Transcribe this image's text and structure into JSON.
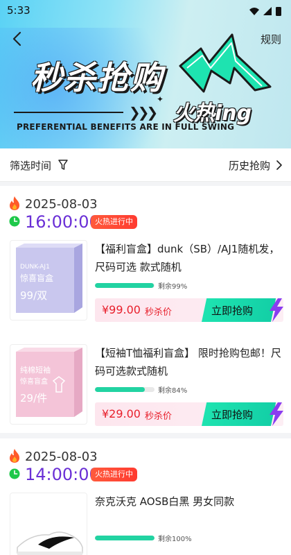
{
  "status_bar": {
    "time": "5:33"
  },
  "header": {
    "rules_label": "规则",
    "banner_title": "秒杀抢购",
    "banner_slogan": "火热ing",
    "banner_subtitle": "PREFERENTIAL BENEFITS ARE IN FULL SWING"
  },
  "filter": {
    "label": "筛选时间",
    "history_label": "历史抢购"
  },
  "sessions": [
    {
      "date": "2025-08-03",
      "time": "16:00:00",
      "badge": "火热进行中",
      "products": [
        {
          "name": "【福利盲盒】dunk（SB）/AJ1随机发，尺码可选 款式随机",
          "remain_text": "剩余99%",
          "remain_fraction": 0.99,
          "price": "¥99.00",
          "price_tag": "秒杀价",
          "buy_label": "立即抢购",
          "box_line1": "DUNK-AJ1",
          "box_line2": "惊喜盲盒",
          "box_price": "99/双",
          "box_color": "#c9c7ee"
        },
        {
          "name": "【短袖T恤福利盲盒】 限时抢购包邮！尺码可选款式随机",
          "remain_text": "剩余84%",
          "remain_fraction": 0.84,
          "price": "¥29.00",
          "price_tag": "秒杀价",
          "buy_label": "立即抢购",
          "box_line1": "纯棉短袖",
          "box_line2": "惊喜盲盒",
          "box_price": "29/件",
          "box_color": "#f4c4d8"
        }
      ]
    },
    {
      "date": "2025-08-03",
      "time": "14:00:00",
      "badge": "火热进行中",
      "products": [
        {
          "name": "奈克沃克 AOSB白黑 男女同款",
          "remain_text": "剩余100%",
          "remain_fraction": 1.0
        }
      ]
    }
  ],
  "colors": {
    "accent_purple": "#6a2fd6",
    "price_red": "#e8202c",
    "buy_green": "#1ee3b0",
    "progress_green": "#22d3a2",
    "badge_red": "#ff3b30"
  }
}
